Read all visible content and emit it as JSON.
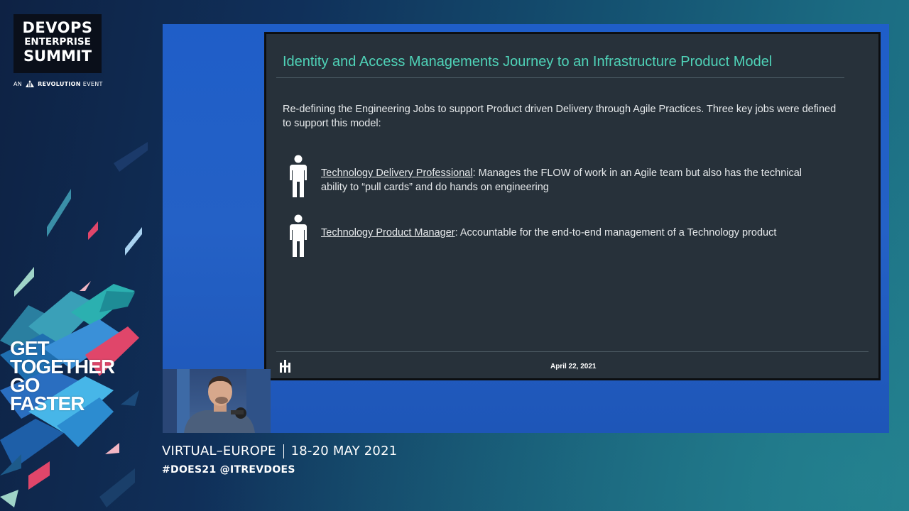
{
  "branding": {
    "logo_line1": "DEVOPS",
    "logo_line2": "ENTERPRISE",
    "logo_line3": "SUMMIT",
    "sub_prefix": "AN",
    "sub_brand": "REVOLUTION",
    "sub_suffix": "EVENT",
    "tagline": [
      "GET",
      "TOGETHER",
      "GO",
      "FASTER"
    ]
  },
  "slide": {
    "title": "Identity and Access Managements Journey to an Infrastructure Product Model",
    "intro": "Re-defining the Engineering Jobs to support Product driven Delivery through Agile Practices.  Three key jobs were defined to support this model:",
    "roles": [
      {
        "name": "Technology Delivery Professional",
        "description": ": Manages the FLOW of work in an Agile team but also has the technical ability to “pull cards” and do hands on engineering"
      },
      {
        "name": "Technology Product Manager",
        "description": ": Accountable for the end-to-end management of a Technology product"
      }
    ],
    "footer_date": "April 22, 2021"
  },
  "event": {
    "location": "VIRTUAL–EUROPE",
    "dates": "18-20 MAY 2021",
    "hashtags": "#DOES21 @ITREVDOES"
  },
  "colors": {
    "slide_title": "#4fd3b8",
    "slide_bg": "#27313a",
    "stage_bg": "#2461c6"
  }
}
